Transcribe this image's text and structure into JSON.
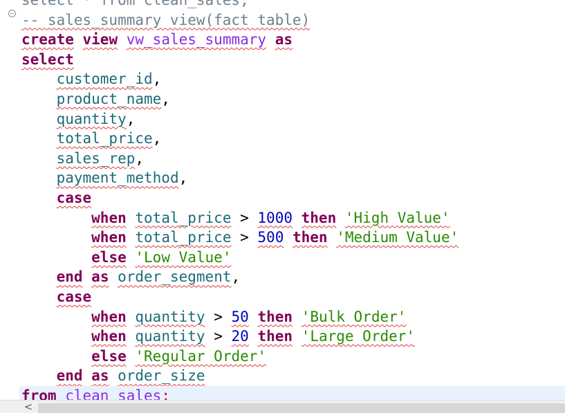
{
  "editor": {
    "fold_icon": "fold-collapse-icon",
    "lines": [
      {
        "segments": [
          {
            "t": "select * from clean_sales;",
            "c": "cm"
          }
        ]
      },
      {
        "segments": [
          {
            "t": "-- sales_summary view(fact table)",
            "c": "cm"
          }
        ]
      },
      {
        "segments": [
          {
            "t": "create",
            "c": "kw"
          },
          {
            "t": " ",
            "c": "op"
          },
          {
            "t": "view",
            "c": "kw"
          },
          {
            "t": " ",
            "c": "op"
          },
          {
            "t": "vw_sales_summary",
            "c": "obj"
          },
          {
            "t": " ",
            "c": "op"
          },
          {
            "t": "as",
            "c": "kw"
          }
        ]
      },
      {
        "segments": [
          {
            "t": "select",
            "c": "kw"
          }
        ]
      },
      {
        "segments": [
          {
            "t": "    ",
            "c": "op"
          },
          {
            "t": "customer_id",
            "c": "id"
          },
          {
            "t": ",",
            "c": "op"
          }
        ]
      },
      {
        "segments": [
          {
            "t": "    ",
            "c": "op"
          },
          {
            "t": "product_name",
            "c": "id"
          },
          {
            "t": ",",
            "c": "op"
          }
        ]
      },
      {
        "segments": [
          {
            "t": "    ",
            "c": "op"
          },
          {
            "t": "quantity",
            "c": "id"
          },
          {
            "t": ",",
            "c": "op"
          }
        ]
      },
      {
        "segments": [
          {
            "t": "    ",
            "c": "op"
          },
          {
            "t": "total_price",
            "c": "id"
          },
          {
            "t": ",",
            "c": "op"
          }
        ]
      },
      {
        "segments": [
          {
            "t": "    ",
            "c": "op"
          },
          {
            "t": "sales_rep",
            "c": "id"
          },
          {
            "t": ",",
            "c": "op"
          }
        ]
      },
      {
        "segments": [
          {
            "t": "    ",
            "c": "op"
          },
          {
            "t": "payment_method",
            "c": "id"
          },
          {
            "t": ",",
            "c": "op"
          }
        ]
      },
      {
        "segments": [
          {
            "t": "    ",
            "c": "op"
          },
          {
            "t": "case",
            "c": "kw"
          }
        ]
      },
      {
        "segments": [
          {
            "t": "        ",
            "c": "op"
          },
          {
            "t": "when",
            "c": "kw"
          },
          {
            "t": " ",
            "c": "op"
          },
          {
            "t": "total_price",
            "c": "id"
          },
          {
            "t": " > ",
            "c": "op"
          },
          {
            "t": "1000",
            "c": "num"
          },
          {
            "t": " ",
            "c": "op"
          },
          {
            "t": "then",
            "c": "kw"
          },
          {
            "t": " ",
            "c": "op"
          },
          {
            "t": "'High Value'",
            "c": "str"
          }
        ]
      },
      {
        "segments": [
          {
            "t": "        ",
            "c": "op"
          },
          {
            "t": "when",
            "c": "kw"
          },
          {
            "t": " ",
            "c": "op"
          },
          {
            "t": "total_price",
            "c": "id"
          },
          {
            "t": " > ",
            "c": "op"
          },
          {
            "t": "500",
            "c": "num"
          },
          {
            "t": " ",
            "c": "op"
          },
          {
            "t": "then",
            "c": "kw"
          },
          {
            "t": " ",
            "c": "op"
          },
          {
            "t": "'Medium Value'",
            "c": "str"
          }
        ]
      },
      {
        "segments": [
          {
            "t": "        ",
            "c": "op"
          },
          {
            "t": "else",
            "c": "kw"
          },
          {
            "t": " ",
            "c": "op"
          },
          {
            "t": "'Low Value'",
            "c": "str"
          }
        ]
      },
      {
        "segments": [
          {
            "t": "    ",
            "c": "op"
          },
          {
            "t": "end",
            "c": "kw"
          },
          {
            "t": " ",
            "c": "op"
          },
          {
            "t": "as",
            "c": "kw"
          },
          {
            "t": " ",
            "c": "op"
          },
          {
            "t": "order_segment",
            "c": "id"
          },
          {
            "t": ",",
            "c": "op"
          }
        ]
      },
      {
        "segments": [
          {
            "t": "    ",
            "c": "op"
          },
          {
            "t": "case",
            "c": "kw"
          }
        ]
      },
      {
        "segments": [
          {
            "t": "        ",
            "c": "op"
          },
          {
            "t": "when",
            "c": "kw"
          },
          {
            "t": " ",
            "c": "op"
          },
          {
            "t": "quantity",
            "c": "id"
          },
          {
            "t": " > ",
            "c": "op"
          },
          {
            "t": "50",
            "c": "num"
          },
          {
            "t": " ",
            "c": "op"
          },
          {
            "t": "then",
            "c": "kw"
          },
          {
            "t": " ",
            "c": "op"
          },
          {
            "t": "'Bulk Order'",
            "c": "str"
          }
        ]
      },
      {
        "segments": [
          {
            "t": "        ",
            "c": "op"
          },
          {
            "t": "when",
            "c": "kw"
          },
          {
            "t": " ",
            "c": "op"
          },
          {
            "t": "quantity",
            "c": "id"
          },
          {
            "t": " > ",
            "c": "op"
          },
          {
            "t": "20",
            "c": "num"
          },
          {
            "t": " ",
            "c": "op"
          },
          {
            "t": "then",
            "c": "kw"
          },
          {
            "t": " ",
            "c": "op"
          },
          {
            "t": "'Large Order'",
            "c": "str"
          }
        ]
      },
      {
        "segments": [
          {
            "t": "        ",
            "c": "op"
          },
          {
            "t": "else",
            "c": "kw"
          },
          {
            "t": " ",
            "c": "op"
          },
          {
            "t": "'Regular Order'",
            "c": "str"
          }
        ]
      },
      {
        "segments": [
          {
            "t": "    ",
            "c": "op"
          },
          {
            "t": "end",
            "c": "kw"
          },
          {
            "t": " ",
            "c": "op"
          },
          {
            "t": "as",
            "c": "kw"
          },
          {
            "t": " ",
            "c": "op"
          },
          {
            "t": "order_size",
            "c": "id"
          }
        ]
      },
      {
        "segments": [
          {
            "t": "from",
            "c": "kw"
          },
          {
            "t": " ",
            "c": "op"
          },
          {
            "t": "clean_sales",
            "c": "obj"
          },
          {
            "t": ";",
            "c": "sem"
          }
        ],
        "current": true
      }
    ]
  },
  "scrollbar": {
    "left_arrow": "<",
    "left_arrow_icon": "chevron-left-icon"
  },
  "colors": {
    "keyword": "#7f0055",
    "identifier": "#1c6a78",
    "number": "#0000c0",
    "string": "#2a8a00",
    "comment": "#6f7f8f",
    "object": "#8a2be2",
    "error_squiggle": "#e23b3b",
    "current_line": "#e8f2fe"
  }
}
